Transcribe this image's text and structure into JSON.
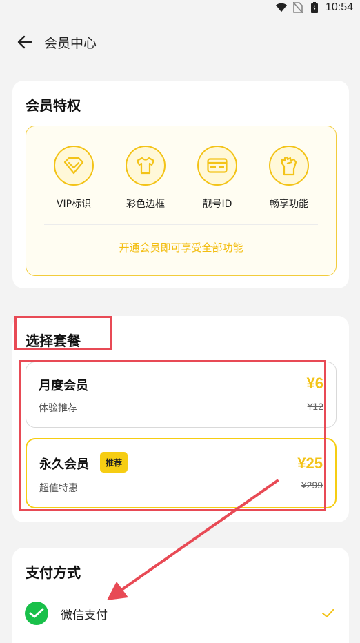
{
  "status_bar": {
    "time": "10:54"
  },
  "header": {
    "title": "会员中心"
  },
  "privileges": {
    "title": "会员特权",
    "items": [
      {
        "label": "VIP标识",
        "icon": "diamond-icon"
      },
      {
        "label": "彩色边框",
        "icon": "shirt-icon"
      },
      {
        "label": "靓号ID",
        "icon": "id-card-icon"
      },
      {
        "label": "畅享功能",
        "icon": "hand-icon"
      }
    ],
    "note": "开通会员即可享受全部功能"
  },
  "plans": {
    "title": "选择套餐",
    "items": [
      {
        "name": "月度会员",
        "desc": "体验推荐",
        "price": "¥6",
        "original_price": "¥12"
      },
      {
        "name": "永久会员",
        "badge": "推荐",
        "desc": "超值特惠",
        "price": "¥25",
        "original_price": "¥299"
      }
    ]
  },
  "payment": {
    "title": "支付方式",
    "methods": [
      {
        "label": "微信支付",
        "icon": "wechat-pay-icon",
        "selected": true
      }
    ]
  },
  "colors": {
    "accent": "#f3c318",
    "annotation": "#e84a55",
    "wechat": "#19c04a"
  }
}
